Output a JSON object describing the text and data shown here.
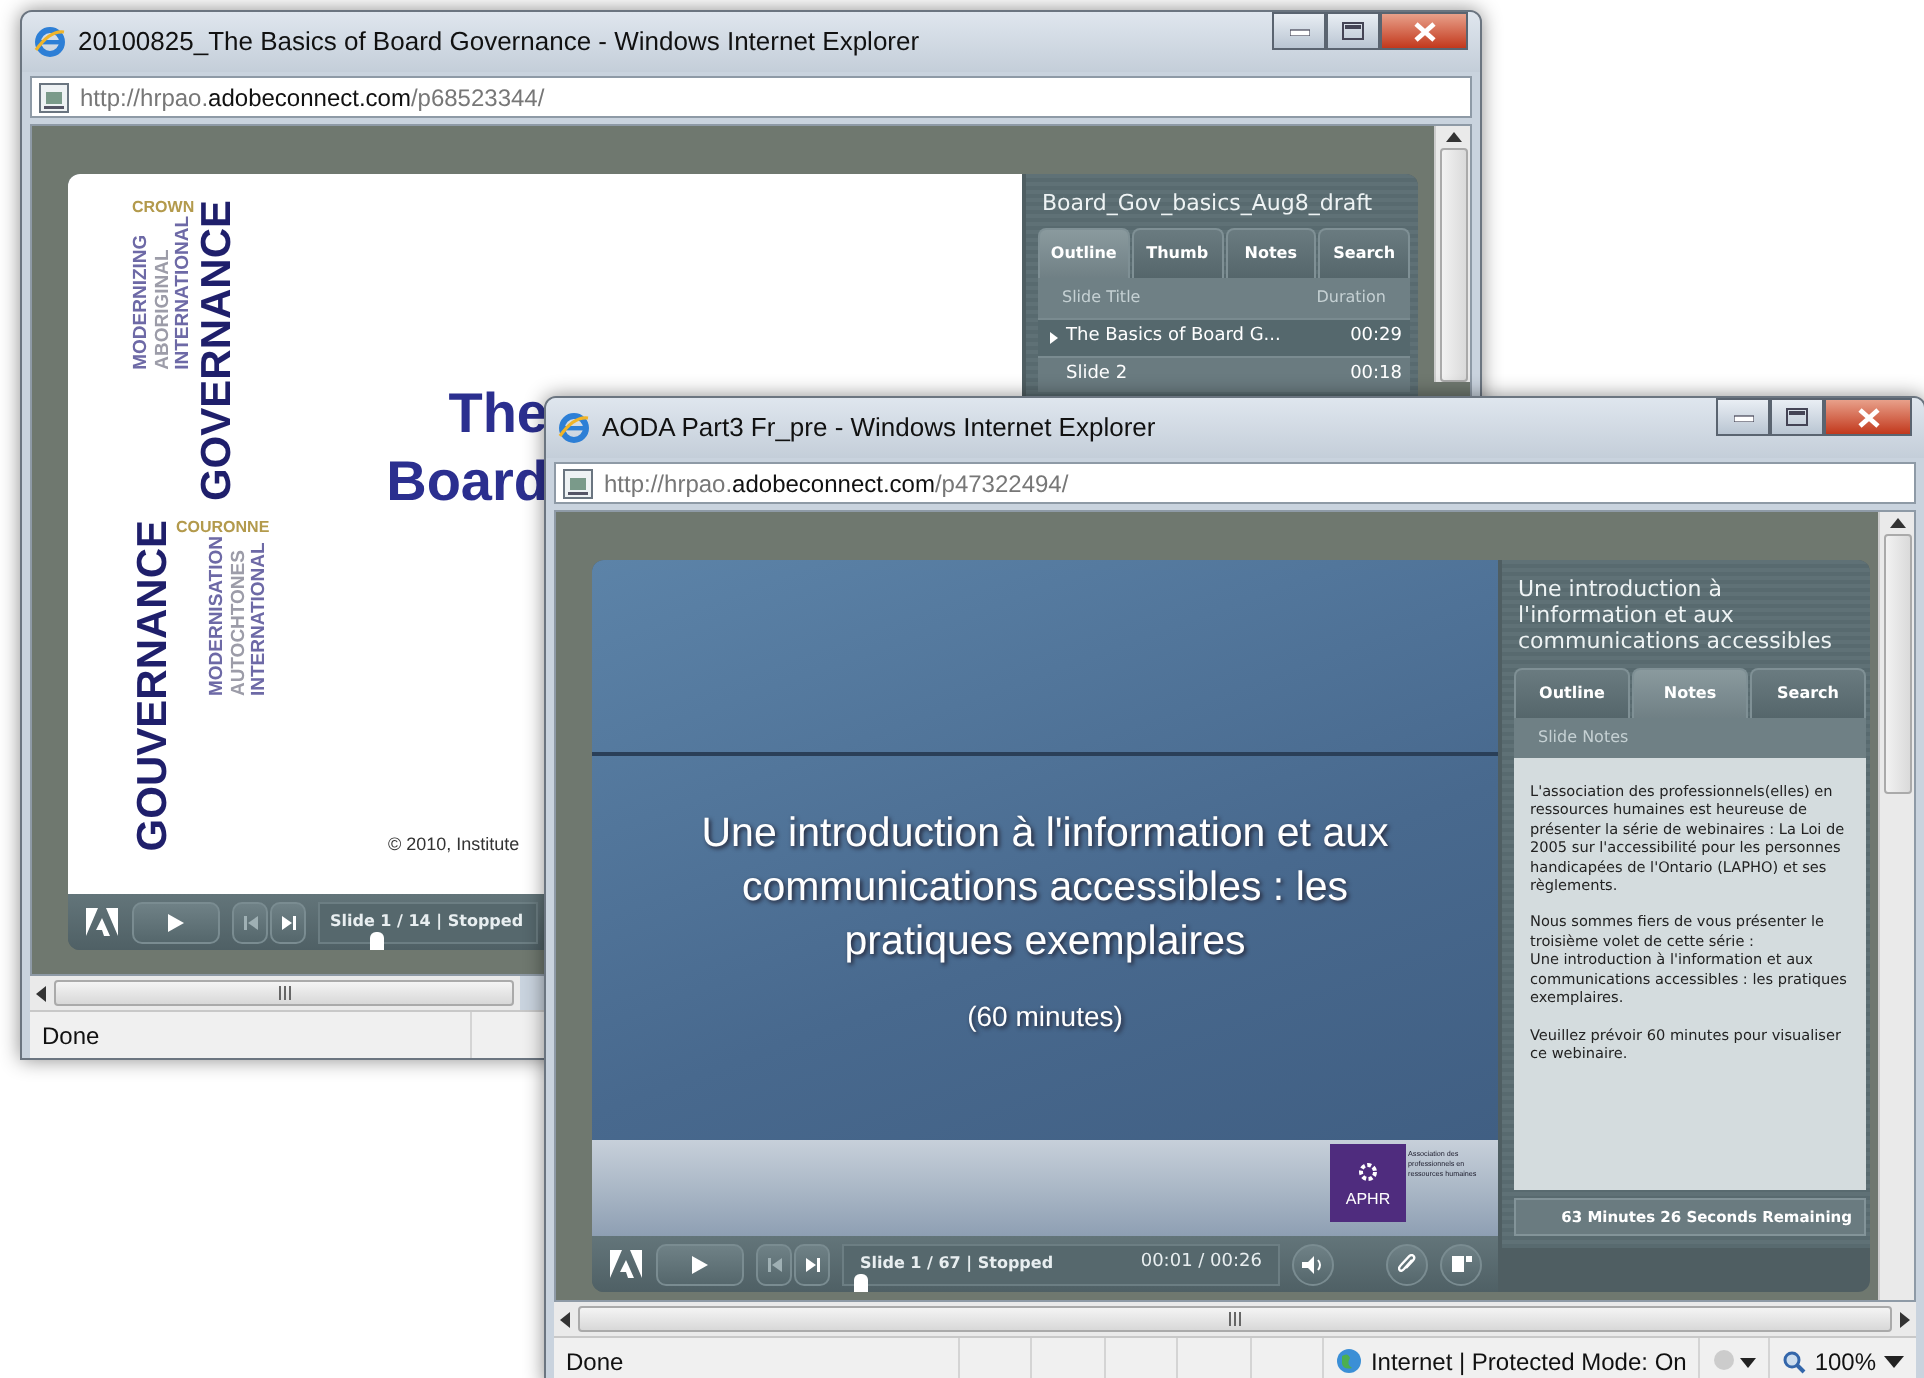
{
  "windows": [
    {
      "title": "20100825_The Basics of Board Governance - Windows Internet Explorer",
      "url": {
        "prefix": "http://hrpao.",
        "domain": "adobeconnect.com",
        "path": "/p68523344/"
      },
      "slide": {
        "kind": "word-cloud",
        "word_groups": [
          {
            "words": [
              {
                "text": "CROWN",
                "kind": "horizontal",
                "color": "#b39a4c"
              },
              {
                "text": "MODERNIZING",
                "kind": "vertical",
                "color": "#6d69a6"
              },
              {
                "text": "ABORIGINAL",
                "kind": "vertical",
                "color": "#9c9ca8"
              },
              {
                "text": "INTERNATIONAL",
                "kind": "vertical",
                "color": "#6d69a6"
              },
              {
                "text": "GOVERNANCE",
                "kind": "large",
                "color": "#1f1f6b"
              }
            ]
          },
          {
            "words": [
              {
                "text": "GOUVERNANCE",
                "kind": "large",
                "color": "#1f1f6b"
              },
              {
                "text": "COURONNE",
                "kind": "horizontal",
                "color": "#b39a4c"
              },
              {
                "text": "MODERNISATION",
                "kind": "vertical",
                "color": "#6d69a6"
              },
              {
                "text": "AUTOCHTONES",
                "kind": "vertical",
                "color": "#9c9ca8"
              },
              {
                "text": "INTERNATIONAL",
                "kind": "vertical",
                "color": "#6d69a6"
              }
            ]
          }
        ],
        "title_lines": [
          "The",
          "Board"
        ],
        "footer": "© 2010, Institute"
      },
      "panel": {
        "kind": "outline",
        "title": "Board_Gov_basics_Aug8_draft",
        "tabs": [
          {
            "label": "Outline",
            "selected": true
          },
          {
            "label": "Thumb",
            "selected": false
          },
          {
            "label": "Notes",
            "selected": false
          },
          {
            "label": "Search",
            "selected": false
          }
        ],
        "columns": [
          "Slide Title",
          "Duration"
        ],
        "rows": [
          {
            "title": "The Basics of Board G...",
            "duration": "00:29",
            "selected": true
          },
          {
            "title": "Slide 2",
            "duration": "00:18",
            "selected": false
          }
        ]
      },
      "player": {
        "slide_status": "Slide 1 / 14 | Stopped",
        "level": 0.26
      },
      "status_bar": {
        "text": "Done"
      }
    },
    {
      "title": "AODA Part3 Fr_pre - Windows Internet Explorer",
      "url": {
        "prefix": "http://hrpao.",
        "domain": "adobeconnect.com",
        "path": "/p47322494/"
      },
      "slide": {
        "kind": "title-slide",
        "title": "Une introduction à l'information et aux communications accessibles : les pratiques exemplaires",
        "subtitle": "(60 minutes)",
        "logo": {
          "text": "APHR",
          "caption": "Association des professionnels en ressources humaines"
        }
      },
      "panel": {
        "kind": "notes",
        "title": "Une introduction à l'information et aux communications accessibles",
        "tabs": [
          {
            "label": "Outline",
            "selected": false
          },
          {
            "label": "Notes",
            "selected": true
          },
          {
            "label": "Search",
            "selected": false
          }
        ],
        "header": "Slide Notes",
        "paragraphs": [
          [
            "L'association des professionnels(elles) en ressources humaines est heureuse de présenter la série de webinaires : La Loi de 2005 sur l'accessibilité pour les personnes handicapées de l'Ontario (LAPHO) et ses règlements."
          ],
          [
            "Nous sommes fiers de vous présenter le troisième volet de cette série :",
            "Une introduction à l'information et aux communications accessibles : les pratiques exemplaires."
          ],
          [
            "Veuillez prévoir 60 minutes pour visualiser ce webinaire."
          ]
        ],
        "footer": "63 Minutes 26 Seconds Remaining"
      },
      "player": {
        "slide_status": "Slide 1 / 67 | Stopped",
        "level": 0.04,
        "time": "00:01 / 00:26"
      },
      "status_bar": {
        "text": "Done",
        "zone": "Internet | Protected Mode: On",
        "zoom": "100%"
      }
    }
  ]
}
